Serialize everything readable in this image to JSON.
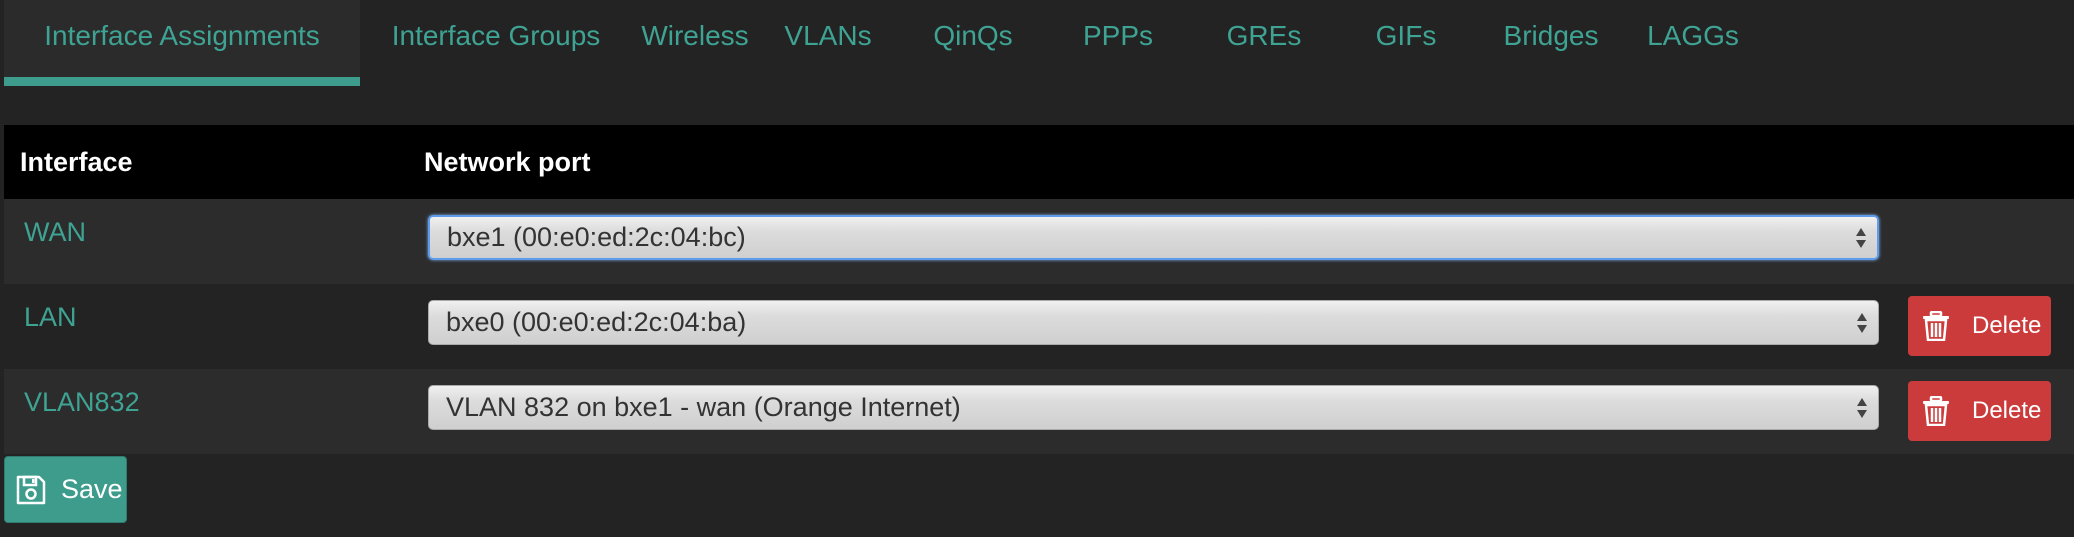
{
  "tabs": [
    {
      "label": "Interface Assignments",
      "active": true
    },
    {
      "label": "Interface Groups",
      "active": false
    },
    {
      "label": "Wireless",
      "active": false
    },
    {
      "label": "VLANs",
      "active": false
    },
    {
      "label": "QinQs",
      "active": false
    },
    {
      "label": "PPPs",
      "active": false
    },
    {
      "label": "GREs",
      "active": false
    },
    {
      "label": "GIFs",
      "active": false
    },
    {
      "label": "Bridges",
      "active": false
    },
    {
      "label": "LAGGs",
      "active": false
    }
  ],
  "table": {
    "headers": {
      "interface": "Interface",
      "network_port": "Network port"
    },
    "rows": [
      {
        "interface": "WAN",
        "port": "bxe1 (00:e0:ed:2c:04:bc)",
        "deletable": false
      },
      {
        "interface": "LAN",
        "port": "bxe0 (00:e0:ed:2c:04:ba)",
        "deletable": true
      },
      {
        "interface": "VLAN832",
        "port": "VLAN 832 on bxe1 - wan (Orange Internet)",
        "deletable": true
      }
    ],
    "delete_label": "Delete"
  },
  "save_label": "Save",
  "colors": {
    "accent": "#3d9c8c",
    "link": "#3ea393",
    "danger": "#cc3b3b",
    "background": "#232323"
  }
}
